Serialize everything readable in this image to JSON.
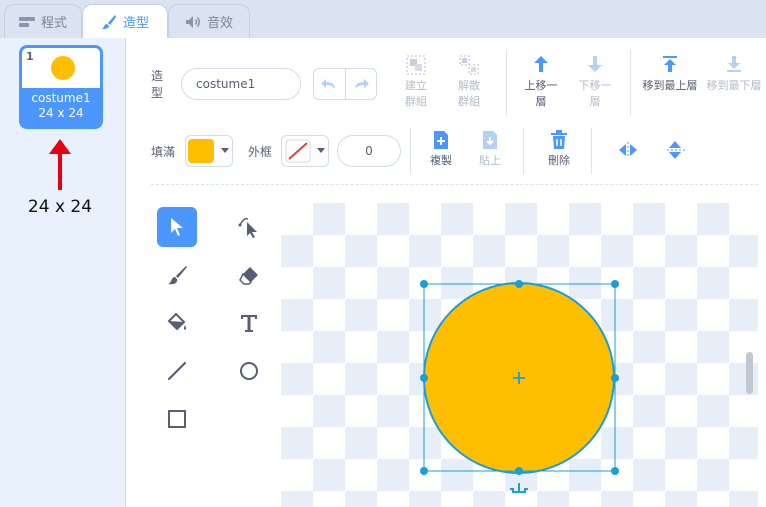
{
  "tabs": [
    {
      "label": "程式",
      "icon": "code-icon",
      "active": false
    },
    {
      "label": "造型",
      "icon": "paintbrush-icon",
      "active": true
    },
    {
      "label": "音效",
      "icon": "speaker-icon",
      "active": false
    }
  ],
  "costume_list": {
    "index": "1",
    "name": "costume1",
    "size": "24 x 24",
    "annotation": "24 x 24"
  },
  "editor": {
    "name_label": "造型",
    "costume_name": "costume1",
    "group": "建立群組",
    "ungroup": "解散群組",
    "forward": "上移一層",
    "backward": "下移一層",
    "front": "移到最上層",
    "back": "移到最下層",
    "fill_label": "填滿",
    "outline_label": "外框",
    "outline_width": "0",
    "copy": "複製",
    "paste": "貼上",
    "delete": "刪除"
  },
  "colors": {
    "accent": "#4c97ff",
    "fill": "#ffbf00",
    "outline_stroke": "#1a9ed8",
    "annotation_arrow": "#e60012"
  }
}
